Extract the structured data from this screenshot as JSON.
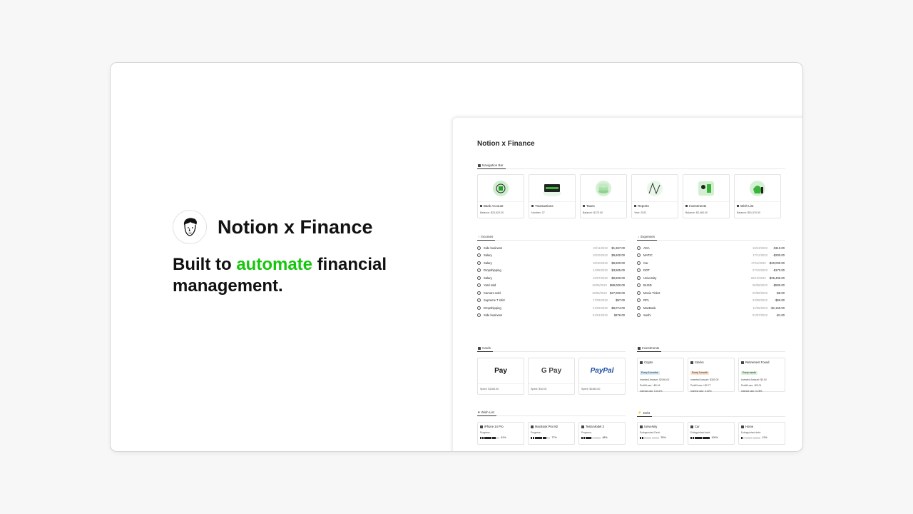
{
  "hero": {
    "title": "Notion x Finance",
    "tagline_pre": "Built to ",
    "tagline_accent": "automate",
    "tagline_post": " financial management.",
    "accent_color": "#16c60c"
  },
  "preview": {
    "title": "Notion x Finance",
    "nav_section": "Navigation Bar",
    "nav_cards": [
      {
        "icon": "bank-icon",
        "label": "Bank Account",
        "sub": "Balance: $23,520.00"
      },
      {
        "icon": "transactions-icon",
        "label": "Transactions",
        "sub": "Number: 27"
      },
      {
        "icon": "taxes-icon",
        "label": "Taxes",
        "sub": "Balance: $170.00"
      },
      {
        "icon": "reports-icon",
        "label": "Reports",
        "sub": "Year: 2022"
      },
      {
        "icon": "investments-icon",
        "label": "Investments",
        "sub": "Balance: $2,460.00"
      },
      {
        "icon": "wishlist-icon",
        "label": "Wish List",
        "sub": "Balance: $51,570.00"
      }
    ],
    "incomes_section": "Incomes",
    "incomes": [
      {
        "name": "Side business",
        "date": "23/11/2022",
        "amount": "$1,367.00"
      },
      {
        "name": "Salary",
        "date": "18/10/2022",
        "amount": "$9,600.00"
      },
      {
        "name": "Salary",
        "date": "18/10/2022",
        "amount": "$9,600.00"
      },
      {
        "name": "Dropshipping",
        "date": "14/08/2022",
        "amount": "$3,865.00"
      },
      {
        "name": "Salary",
        "date": "18/07/2022",
        "amount": "$9,600.00"
      },
      {
        "name": "Yard sold",
        "date": "16/05/2022",
        "amount": "$89,000.00"
      },
      {
        "name": "Camaro sold",
        "date": "16/05/2022",
        "amount": "$27,000.00"
      },
      {
        "name": "Supreme T shirt",
        "date": "17/03/2022",
        "amount": "$87.00"
      },
      {
        "name": "Dropshipping",
        "date": "31/03/2022",
        "amount": "$9,074.00"
      },
      {
        "name": "Side business",
        "date": "01/01/2022",
        "amount": "$476.00"
      }
    ],
    "expenses_section": "Expenses",
    "expenses": [
      {
        "name": "ADA",
        "date": "19/12/2023",
        "amount": "-$110.00"
      },
      {
        "name": "MATIC",
        "date": "17/11/2023",
        "amount": "-$200.00"
      },
      {
        "name": "Car",
        "date": "17/11/2023",
        "amount": "-$20,000.00"
      },
      {
        "name": "DOT",
        "date": "27/10/2023",
        "amount": "-$170.00"
      },
      {
        "name": "University",
        "date": "25/10/2023",
        "amount": "-$25,405.00"
      },
      {
        "name": "BUSD",
        "date": "06/08/2023",
        "amount": "-$500.00"
      },
      {
        "name": "Movie Ticket",
        "date": "02/08/2023",
        "amount": "-$8.00"
      },
      {
        "name": "RPL",
        "date": "23/08/2023",
        "amount": "-$60.00"
      },
      {
        "name": "MacBook",
        "date": "11/06/2023",
        "amount": "-$1,159.00"
      },
      {
        "name": "Sushi",
        "date": "01/07/2023",
        "amount": "-$1.00"
      }
    ],
    "cards_section": "Cards",
    "pay_cards": [
      {
        "logo": " Pay",
        "sub": "Spent: $1184.00"
      },
      {
        "logo": "G Pay",
        "sub": "Spent: $10.00"
      },
      {
        "logo": "PayPal",
        "sub": "Spent: $2460.00"
      }
    ],
    "investments_section": "Investments",
    "investments": [
      {
        "name": "Crypto",
        "tag": "Every 6 months",
        "tag_color": "#d8ecf8",
        "l1": "Invested Amount: $2160.00",
        "l2": "Profit/Loss: +$0.16",
        "l3": "Interest rate: 0.012%"
      },
      {
        "name": "Stocks",
        "tag": "Every 3 month",
        "tag_color": "#fbe0cf",
        "l1": "Invested Amount: $300.00",
        "l2": "Profit/Loss: +$0.77",
        "l3": "Interest rate: 0.02%"
      },
      {
        "name": "Retirement Found",
        "tag": "Every month",
        "tag_color": "#dcf3dc",
        "l1": "Invested Amount: $0.00",
        "l2": "Profit/Loss: +$2.01",
        "l3": "Interest rate: 0.28%"
      }
    ],
    "wishlist_section": "Wish List",
    "wishlist": [
      {
        "name": "iPhone 14 Pro",
        "label": "Progress:",
        "pct": "81%",
        "filled": 8
      },
      {
        "name": "MacBook Pro M2",
        "label": "Progress:",
        "pct": "77%",
        "filled": 8
      },
      {
        "name": "Tesla Model 3",
        "label": "Progress:",
        "pct": "48%",
        "filled": 5
      }
    ],
    "debt_section": "Debt",
    "debts": [
      {
        "name": "University",
        "label": "Extinguished Debt:",
        "pct": "25%",
        "filled": 2
      },
      {
        "name": "Car",
        "label": "Extinguished debt:",
        "pct": "100%",
        "filled": 10
      },
      {
        "name": "Home",
        "label": "Extinguished debt:",
        "pct": "12%",
        "filled": 1
      }
    ]
  }
}
